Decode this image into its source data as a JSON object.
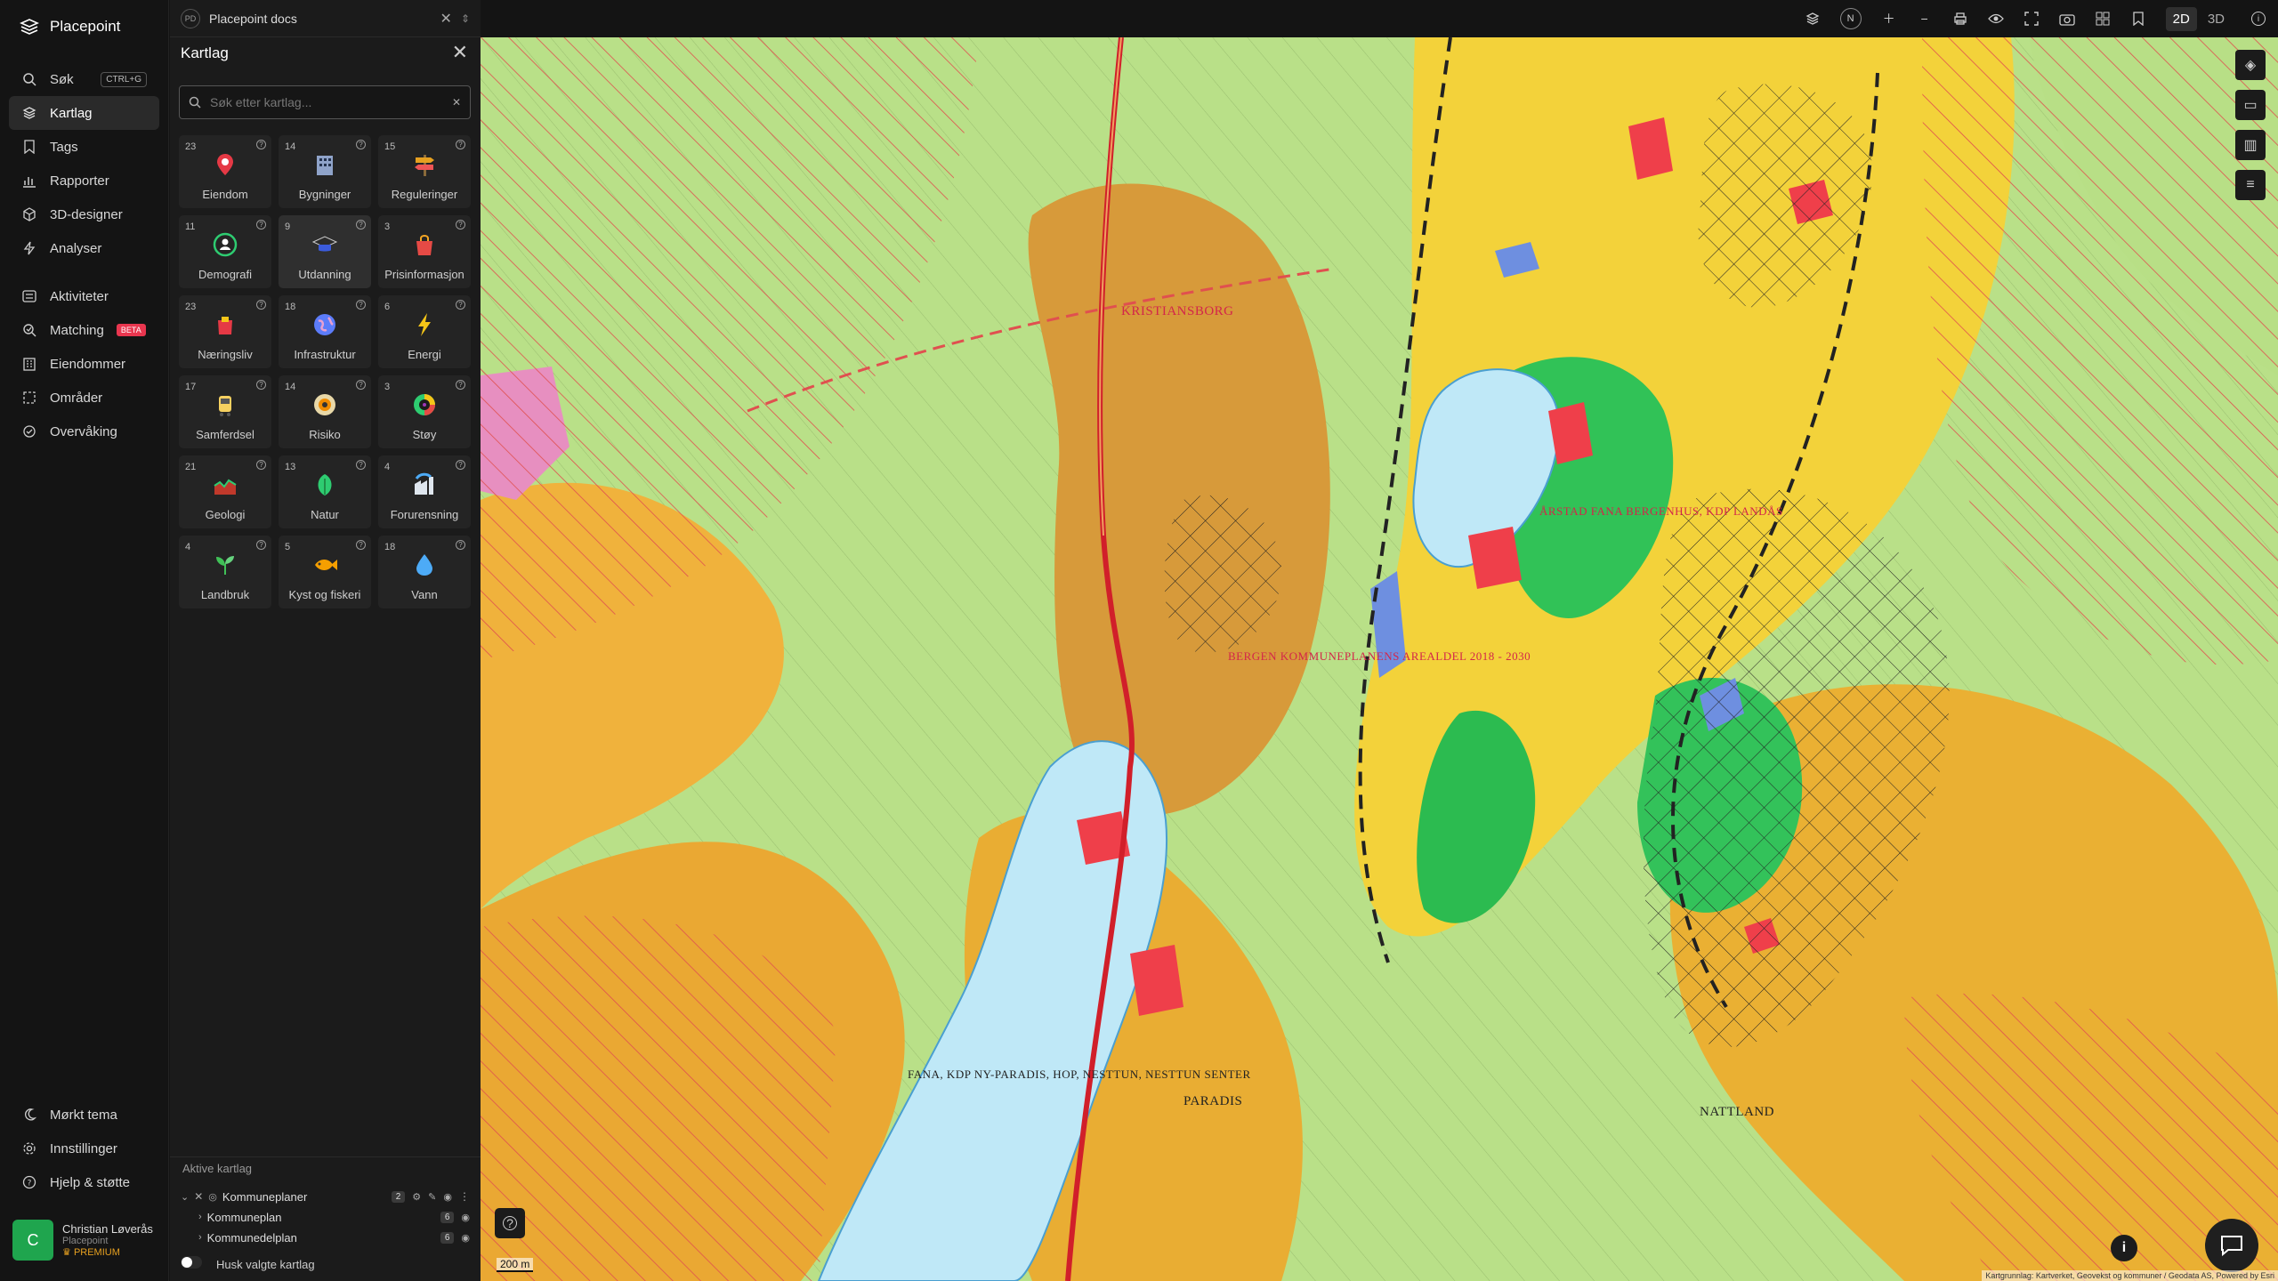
{
  "brand": {
    "name": "Placepoint"
  },
  "nav": {
    "items": [
      {
        "label": "Søk",
        "shortcut": "CTRL+G",
        "icon": "search-icon"
      },
      {
        "label": "Kartlag",
        "icon": "layers-icon",
        "active": true
      },
      {
        "label": "Tags",
        "icon": "bookmark-icon"
      },
      {
        "label": "Rapporter",
        "icon": "bar-chart-icon"
      },
      {
        "label": "3D-designer",
        "icon": "cube-icon"
      },
      {
        "label": "Analyser",
        "icon": "bolt-icon"
      },
      {
        "label": "Aktiviteter",
        "icon": "list-icon"
      },
      {
        "label": "Matching",
        "badge": "BETA",
        "icon": "matching-icon"
      },
      {
        "label": "Eiendommer",
        "icon": "building-icon"
      },
      {
        "label": "Områder",
        "icon": "area-icon"
      },
      {
        "label": "Overvåking",
        "icon": "monitor-icon"
      }
    ],
    "bottom": [
      {
        "label": "Mørkt tema",
        "icon": "moon-icon"
      },
      {
        "label": "Innstillinger",
        "icon": "gear-icon"
      },
      {
        "label": "Hjelp & støtte",
        "icon": "help-icon"
      }
    ]
  },
  "user": {
    "initial": "C",
    "name": "Christian Løverås",
    "org": "Placepoint",
    "plan": "PREMIUM"
  },
  "tab": {
    "badge": "PD",
    "title": "Placepoint docs"
  },
  "panel": {
    "title": "Kartlag",
    "search_placeholder": "Søk etter kartlag...",
    "active_title": "Aktive kartlag",
    "remember_label": "Husk valgte kartlag"
  },
  "categories": [
    {
      "count": "23",
      "label": "Eiendom",
      "icon": "pin-icon",
      "color": "#e53945"
    },
    {
      "count": "14",
      "label": "Bygninger",
      "icon": "building-icon",
      "color": "#8fa3c9"
    },
    {
      "count": "15",
      "label": "Reguleringer",
      "icon": "signpost-icon",
      "color": "#e6a020"
    },
    {
      "count": "11",
      "label": "Demografi",
      "icon": "people-icon",
      "color": "#2ecc71"
    },
    {
      "count": "9",
      "label": "Utdanning",
      "icon": "graduation-icon",
      "color": "#3b5bdb",
      "active": true
    },
    {
      "count": "3",
      "label": "Prisinformasjon",
      "icon": "bag-icon",
      "color": "#e64a45"
    },
    {
      "count": "23",
      "label": "Næringsliv",
      "icon": "shop-icon",
      "color": "#e53945"
    },
    {
      "count": "18",
      "label": "Infrastruktur",
      "icon": "globe-icon",
      "color": "#5c7cfa"
    },
    {
      "count": "6",
      "label": "Energi",
      "icon": "lightning-icon",
      "color": "#f5c518"
    },
    {
      "count": "17",
      "label": "Samferdsel",
      "icon": "bus-icon",
      "color": "#f5d060"
    },
    {
      "count": "14",
      "label": "Risiko",
      "icon": "warning-icon",
      "color": "#f08c00"
    },
    {
      "count": "3",
      "label": "Støy",
      "icon": "noise-icon",
      "color": "#9c36b5"
    },
    {
      "count": "21",
      "label": "Geologi",
      "icon": "terrain-icon",
      "color": "#c0392b"
    },
    {
      "count": "13",
      "label": "Natur",
      "icon": "leaf-icon",
      "color": "#2ecc71"
    },
    {
      "count": "4",
      "label": "Forurensning",
      "icon": "factory-icon",
      "color": "#4dabf7"
    },
    {
      "count": "4",
      "label": "Landbruk",
      "icon": "sprout-icon",
      "color": "#40c057"
    },
    {
      "count": "5",
      "label": "Kyst og fiskeri",
      "icon": "fish-icon",
      "color": "#f59f00"
    },
    {
      "count": "18",
      "label": "Vann",
      "icon": "drop-icon",
      "color": "#4dabf7"
    }
  ],
  "active_layers": [
    {
      "label": "Kommuneplaner",
      "count": "2",
      "group": true
    },
    {
      "label": "Kommuneplan",
      "count": "6"
    },
    {
      "label": "Kommunedelplan",
      "count": "6"
    }
  ],
  "map": {
    "modes": [
      "2D",
      "3D"
    ],
    "active_mode": "2D",
    "compass": "N",
    "scale": "200 m",
    "attribution": "Kartgrunnlag: Kartverket, Geovekst og kommuner / Geodata AS, Powered by Esri",
    "labels": [
      "KRISTIANSBORG",
      "BERGEN KOMMUNEPLANENS AREALDEL 2018 - 2030",
      "ÅRSTAD FANA BERGENHUS, KDP LANDÅS",
      "FANA, KDP NY-PARADIS, HOP, NESTTUN, NESTTUN SENTER",
      "PARADIS",
      "NATTLAND"
    ]
  }
}
